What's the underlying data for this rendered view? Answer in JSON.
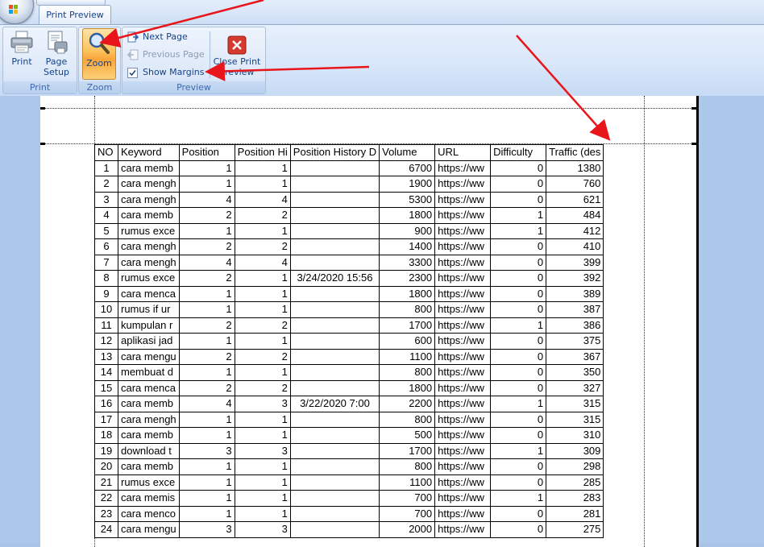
{
  "ribbon": {
    "tab": "Print Preview",
    "groups": [
      {
        "label": "Print"
      },
      {
        "label": "Zoom"
      },
      {
        "label": "Preview"
      }
    ],
    "print_label": "Print",
    "page_setup_label": "Page Setup",
    "zoom_label": "Zoom",
    "next_page_label": "Next Page",
    "previous_page_label": "Previous Page",
    "show_margins_label": "Show Margins",
    "show_margins_checked": true,
    "close_print_preview_label": "Close Print Preview"
  },
  "colors": {
    "accent": "#15428b",
    "zoom_active": "#f9a53b",
    "arrow": "#e8151b",
    "close_red": "#d63a2f"
  },
  "sheet": {
    "headers": [
      "NO",
      "Keyword",
      "Position",
      "Position Hi",
      "Position History D",
      "Volume",
      "URL",
      "Difficulty",
      "Traffic (des"
    ],
    "rows": [
      [
        "1",
        "cara memb",
        "1",
        "1",
        "",
        "6700",
        "https://ww",
        "0",
        "1380"
      ],
      [
        "2",
        "cara mengh",
        "1",
        "1",
        "",
        "1900",
        "https://ww",
        "0",
        "760"
      ],
      [
        "3",
        "cara mengh",
        "4",
        "4",
        "",
        "5300",
        "https://ww",
        "0",
        "621"
      ],
      [
        "4",
        "cara memb",
        "2",
        "2",
        "",
        "1800",
        "https://ww",
        "1",
        "484"
      ],
      [
        "5",
        "rumus exce",
        "1",
        "1",
        "",
        "900",
        "https://ww",
        "1",
        "412"
      ],
      [
        "6",
        "cara mengh",
        "2",
        "2",
        "",
        "1400",
        "https://ww",
        "0",
        "410"
      ],
      [
        "7",
        "cara mengh",
        "4",
        "4",
        "",
        "3300",
        "https://ww",
        "0",
        "399"
      ],
      [
        "8",
        "rumus exce",
        "2",
        "1",
        "3/24/2020 15:56",
        "2300",
        "https://ww",
        "0",
        "392"
      ],
      [
        "9",
        "cara menca",
        "1",
        "1",
        "",
        "1800",
        "https://ww",
        "0",
        "389"
      ],
      [
        "10",
        "rumus if ur",
        "1",
        "1",
        "",
        "800",
        "https://ww",
        "0",
        "387"
      ],
      [
        "11",
        "kumpulan r",
        "2",
        "2",
        "",
        "1700",
        "https://ww",
        "1",
        "386"
      ],
      [
        "12",
        "aplikasi jad",
        "1",
        "1",
        "",
        "600",
        "https://ww",
        "0",
        "375"
      ],
      [
        "13",
        "cara mengu",
        "2",
        "2",
        "",
        "1100",
        "https://ww",
        "0",
        "367"
      ],
      [
        "14",
        "membuat d",
        "1",
        "1",
        "",
        "800",
        "https://ww",
        "0",
        "350"
      ],
      [
        "15",
        "cara menca",
        "2",
        "2",
        "",
        "1800",
        "https://ww",
        "0",
        "327"
      ],
      [
        "16",
        "cara memb",
        "4",
        "3",
        "3/22/2020 7:00",
        "2200",
        "https://ww",
        "1",
        "315"
      ],
      [
        "17",
        "cara mengh",
        "1",
        "1",
        "",
        "800",
        "https://ww",
        "0",
        "315"
      ],
      [
        "18",
        "cara memb",
        "1",
        "1",
        "",
        "500",
        "https://ww",
        "0",
        "310"
      ],
      [
        "19",
        "download t",
        "3",
        "3",
        "",
        "1700",
        "https://ww",
        "1",
        "309"
      ],
      [
        "20",
        "cara memb",
        "1",
        "1",
        "",
        "800",
        "https://ww",
        "0",
        "298"
      ],
      [
        "21",
        "rumus exce",
        "1",
        "1",
        "",
        "1100",
        "https://ww",
        "0",
        "285"
      ],
      [
        "22",
        "cara memis",
        "1",
        "1",
        "",
        "700",
        "https://ww",
        "1",
        "283"
      ],
      [
        "23",
        "cara menco",
        "1",
        "1",
        "",
        "700",
        "https://ww",
        "0",
        "281"
      ],
      [
        "24",
        "cara mengu",
        "3",
        "3",
        "",
        "2000",
        "https://ww",
        "0",
        "275"
      ]
    ]
  }
}
